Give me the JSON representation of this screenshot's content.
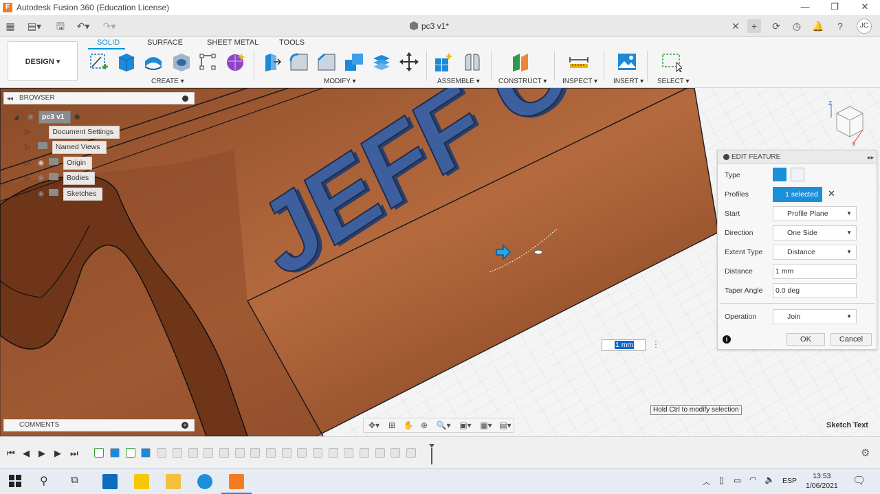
{
  "window": {
    "title": "Autodesk Fusion 360 (Education License)",
    "app_icon_letter": "F"
  },
  "document_tab": {
    "title": "pc3 v1*",
    "user_initials": "JC"
  },
  "toolbar": {
    "design_label": "DESIGN ▾",
    "workspace_tabs": [
      "SOLID",
      "SURFACE",
      "SHEET METAL",
      "TOOLS"
    ],
    "groups": [
      "CREATE ▾",
      "MODIFY ▾",
      "ASSEMBLE ▾",
      "CONSTRUCT ▾",
      "INSPECT ▾",
      "INSERT ▾",
      "SELECT ▾"
    ]
  },
  "browser": {
    "header": "BROWSER",
    "root": "pc3 v1",
    "items": [
      "Document Settings",
      "Named Views",
      "Origin",
      "Bodies",
      "Sketches"
    ]
  },
  "comments": {
    "header": "COMMENTS"
  },
  "edit_feature": {
    "header": "EDIT FEATURE",
    "type_label": "Type",
    "profiles_label": "Profiles",
    "profiles_value": "1 selected",
    "start_label": "Start",
    "start_value": "Profile Plane",
    "direction_label": "Direction",
    "direction_value": "One Side",
    "extent_label": "Extent Type",
    "extent_value": "Distance",
    "distance_label": "Distance",
    "distance_value": "1 mm",
    "taper_label": "Taper Angle",
    "taper_value": "0.0 deg",
    "operation_label": "Operation",
    "operation_value": "Join",
    "ok": "OK",
    "cancel": "Cancel"
  },
  "viewport": {
    "extruded_text": "JEFF C.J",
    "distance_input": "1 mm",
    "hint": "Hold Ctrl to modify selection",
    "status": "Sketch Text"
  },
  "taskbar": {
    "language": "ESP",
    "time": "13:53",
    "date": "1/06/2021"
  },
  "colors": {
    "accent": "#0696d7",
    "wood": "#a0582f",
    "text_body": "#3e5f9e"
  }
}
